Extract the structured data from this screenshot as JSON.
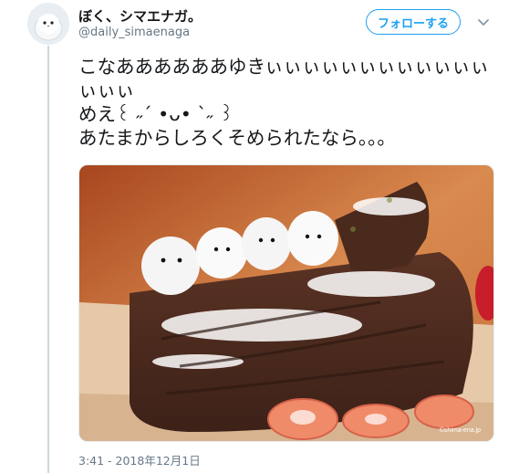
{
  "user": {
    "display_name": "ぼく、シマエナガ。",
    "handle": "@daily_simaenaga",
    "avatar_icon": "long-tailed-tit-avatar"
  },
  "follow_button": {
    "label": "フォローする",
    "color": "#1da1f2"
  },
  "menu": {
    "icon": "chevron-down-icon"
  },
  "tweet": {
    "text": "こなああああああゆきぃぃぃぃぃぃぃぃぃぃぃぃぃぃぃ\nめえ꒰ ˶´ •ᴗ• `˶ ꒱\nあたまからしろくそめられたなら。。。"
  },
  "media": {
    "alt": "シマエナガのマシュマロがのったブッシュドノエル",
    "watermark": "©shima-ena.jp"
  },
  "timestamp": "3:41 - 2018年12月1日",
  "colors": {
    "accent": "#1da1f2",
    "muted": "#657786",
    "thread": "#ccd6dd"
  }
}
